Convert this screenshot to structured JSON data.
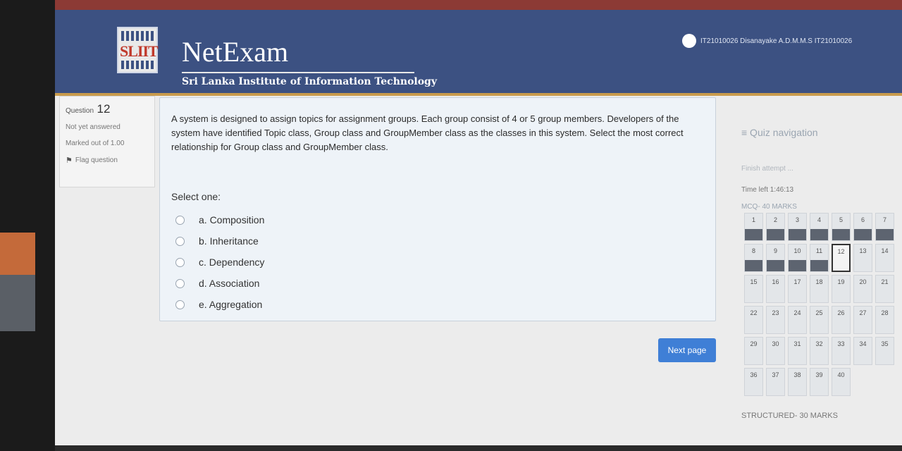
{
  "header": {
    "brand_title": "NetExam",
    "brand_subtitle": "Sri Lanka Institute of Information Technology",
    "logo_text": "SLIIT",
    "user_name": "IT21010026 Disanayake A.D.M.M.S IT21010026"
  },
  "question_info": {
    "label": "Question",
    "number": "12",
    "state": "Not yet answered",
    "marks": "Marked out of 1.00",
    "flag": "Flag question"
  },
  "question": {
    "text": "A system is designed to assign topics for assignment groups. Each group consist of 4 or 5 group members. Developers of the system have identified Topic class, Group class and GroupMember class as the classes in this system. Select the most correct relationship for Group class and GroupMember class.",
    "select_one": "Select one:",
    "options": [
      "a. Composition",
      "b. Inheritance",
      "c. Dependency",
      "d. Association",
      "e. Aggregation"
    ]
  },
  "next_button": "Next page",
  "nav": {
    "title": "≡ Quiz navigation",
    "finish": "Finish attempt ...",
    "time_left": "Time left 1:46:13",
    "section_mcq": "MCQ- 40 MARKS",
    "section_structured": "STRUCTURED- 30 MARKS",
    "current": 12,
    "answered": [
      1,
      2,
      3,
      4,
      5,
      6,
      7,
      8,
      9,
      10,
      11
    ],
    "questions": [
      "1",
      "2",
      "3",
      "4",
      "5",
      "6",
      "7",
      "8",
      "9",
      "10",
      "11",
      "12",
      "13",
      "14",
      "15",
      "16",
      "17",
      "18",
      "19",
      "20",
      "21",
      "22",
      "23",
      "24",
      "25",
      "26",
      "27",
      "28",
      "29",
      "30",
      "31",
      "32",
      "33",
      "34",
      "35",
      "36",
      "37",
      "38",
      "39",
      "40"
    ]
  }
}
